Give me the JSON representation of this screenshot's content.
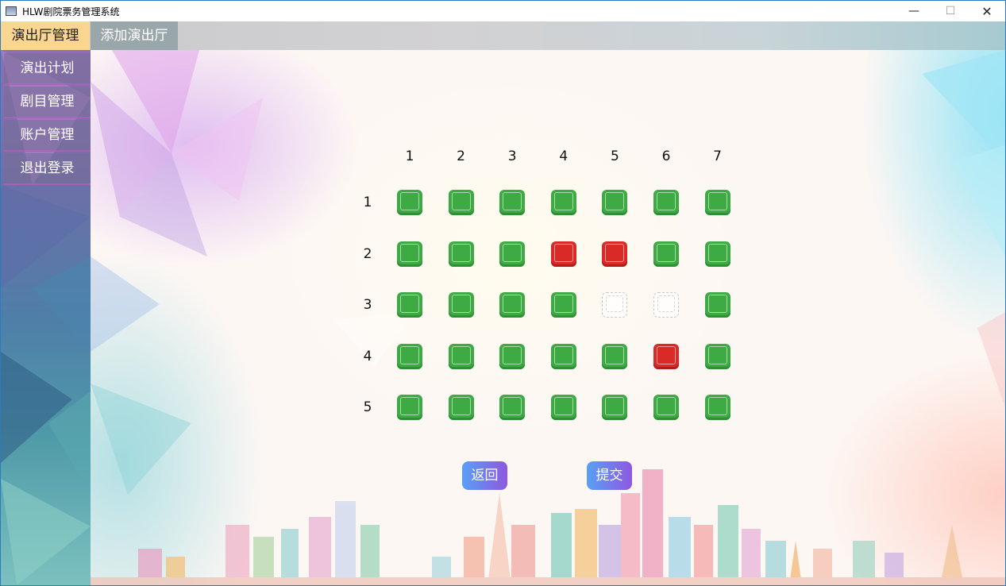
{
  "window": {
    "title": "HLW剧院票务管理系统",
    "controls": {
      "minimize": "—",
      "maximize": "☐",
      "close": "✕"
    }
  },
  "topbar": {
    "tabs": [
      {
        "label": "演出厅管理",
        "active": true
      },
      {
        "label": "添加演出厅",
        "active": false
      }
    ]
  },
  "sidebar": {
    "items": [
      {
        "label": "演出计划"
      },
      {
        "label": "剧目管理"
      },
      {
        "label": "账户管理"
      },
      {
        "label": "退出登录"
      }
    ]
  },
  "seat_map": {
    "columns": [
      "1",
      "2",
      "3",
      "4",
      "5",
      "6",
      "7"
    ],
    "rows": [
      {
        "label": "1",
        "seats": [
          "available",
          "available",
          "available",
          "available",
          "available",
          "available",
          "available"
        ]
      },
      {
        "label": "2",
        "seats": [
          "available",
          "available",
          "available",
          "sold",
          "sold",
          "available",
          "available"
        ]
      },
      {
        "label": "3",
        "seats": [
          "available",
          "available",
          "available",
          "available",
          "empty",
          "empty",
          "available"
        ]
      },
      {
        "label": "4",
        "seats": [
          "available",
          "available",
          "available",
          "available",
          "available",
          "sold",
          "available"
        ]
      },
      {
        "label": "5",
        "seats": [
          "available",
          "available",
          "available",
          "available",
          "available",
          "available",
          "available"
        ]
      }
    ],
    "colors": {
      "available": "#3daa44",
      "sold": "#d92a27",
      "empty": "#ffffff"
    }
  },
  "actions": {
    "back_label": "返回",
    "submit_label": "提交"
  },
  "colors": {
    "active_tab": "#fbd690",
    "button_gradient_start": "#58a0f5",
    "button_gradient_end": "#8e58e0"
  }
}
